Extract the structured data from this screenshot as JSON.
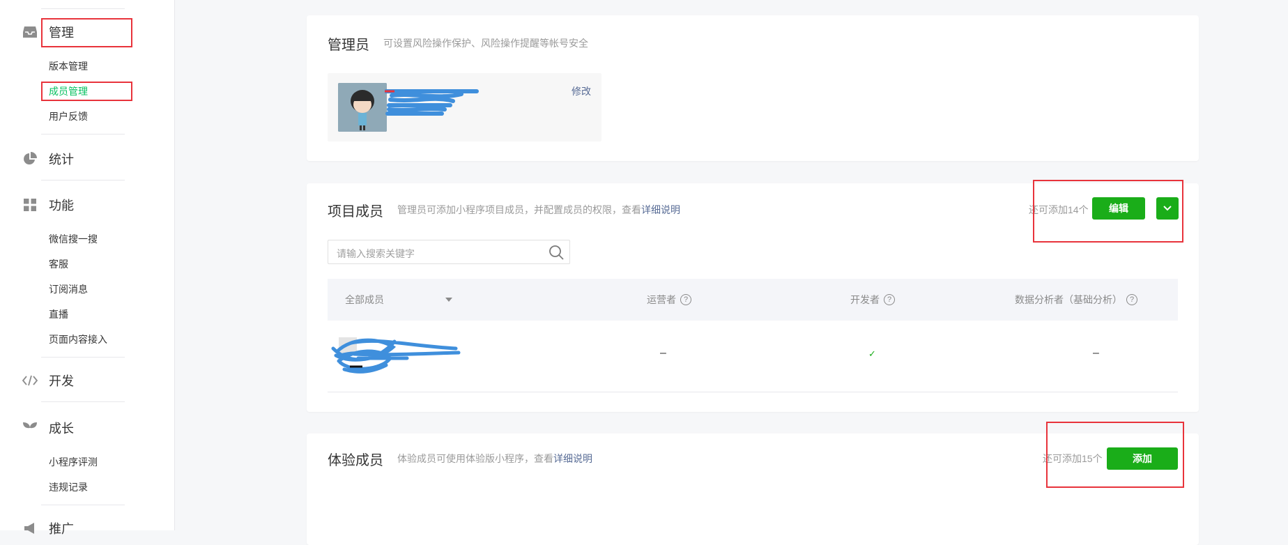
{
  "sidebar": {
    "groups": [
      {
        "label": "管理",
        "icon": "inbox-icon"
      },
      {
        "label": "统计",
        "icon": "pie-chart-icon"
      },
      {
        "label": "功能",
        "icon": "grid-icon"
      },
      {
        "label": "开发",
        "icon": "code-icon"
      },
      {
        "label": "成长",
        "icon": "sprout-icon"
      },
      {
        "label": "推广",
        "icon": "megaphone-icon"
      }
    ],
    "manage_items": [
      "版本管理",
      "成员管理",
      "用户反馈"
    ],
    "feature_items": [
      "微信搜一搜",
      "客服",
      "订阅消息",
      "直播",
      "页面内容接入"
    ],
    "growth_items": [
      "小程序评测",
      "违规记录"
    ]
  },
  "admin": {
    "title": "管理员",
    "desc": "可设置风险操作保护、风险操作提醒等帐号安全",
    "modify": "修改"
  },
  "project_members": {
    "title": "项目成员",
    "desc": "管理员可添加小程序项目成员，并配置成员的权限，查看",
    "desc_link": "详细说明",
    "quota": "还可添加14个",
    "edit_button": "编辑",
    "search_placeholder": "请输入搜索关键字",
    "columns": {
      "all": "全部成员",
      "operator": "运营者",
      "developer": "开发者",
      "analyst": "数据分析者（基础分析）"
    },
    "row": {
      "operator": "–",
      "developer": "✓",
      "analyst": "–"
    }
  },
  "trial_members": {
    "title": "体验成员",
    "desc": "体验成员可使用体验版小程序，查看",
    "desc_link": "详细说明",
    "quota": "还可添加15个",
    "add_button": "添加"
  },
  "colors": {
    "accent": "#1aad19",
    "link": "#576b95",
    "highlight": "#e8333b"
  }
}
